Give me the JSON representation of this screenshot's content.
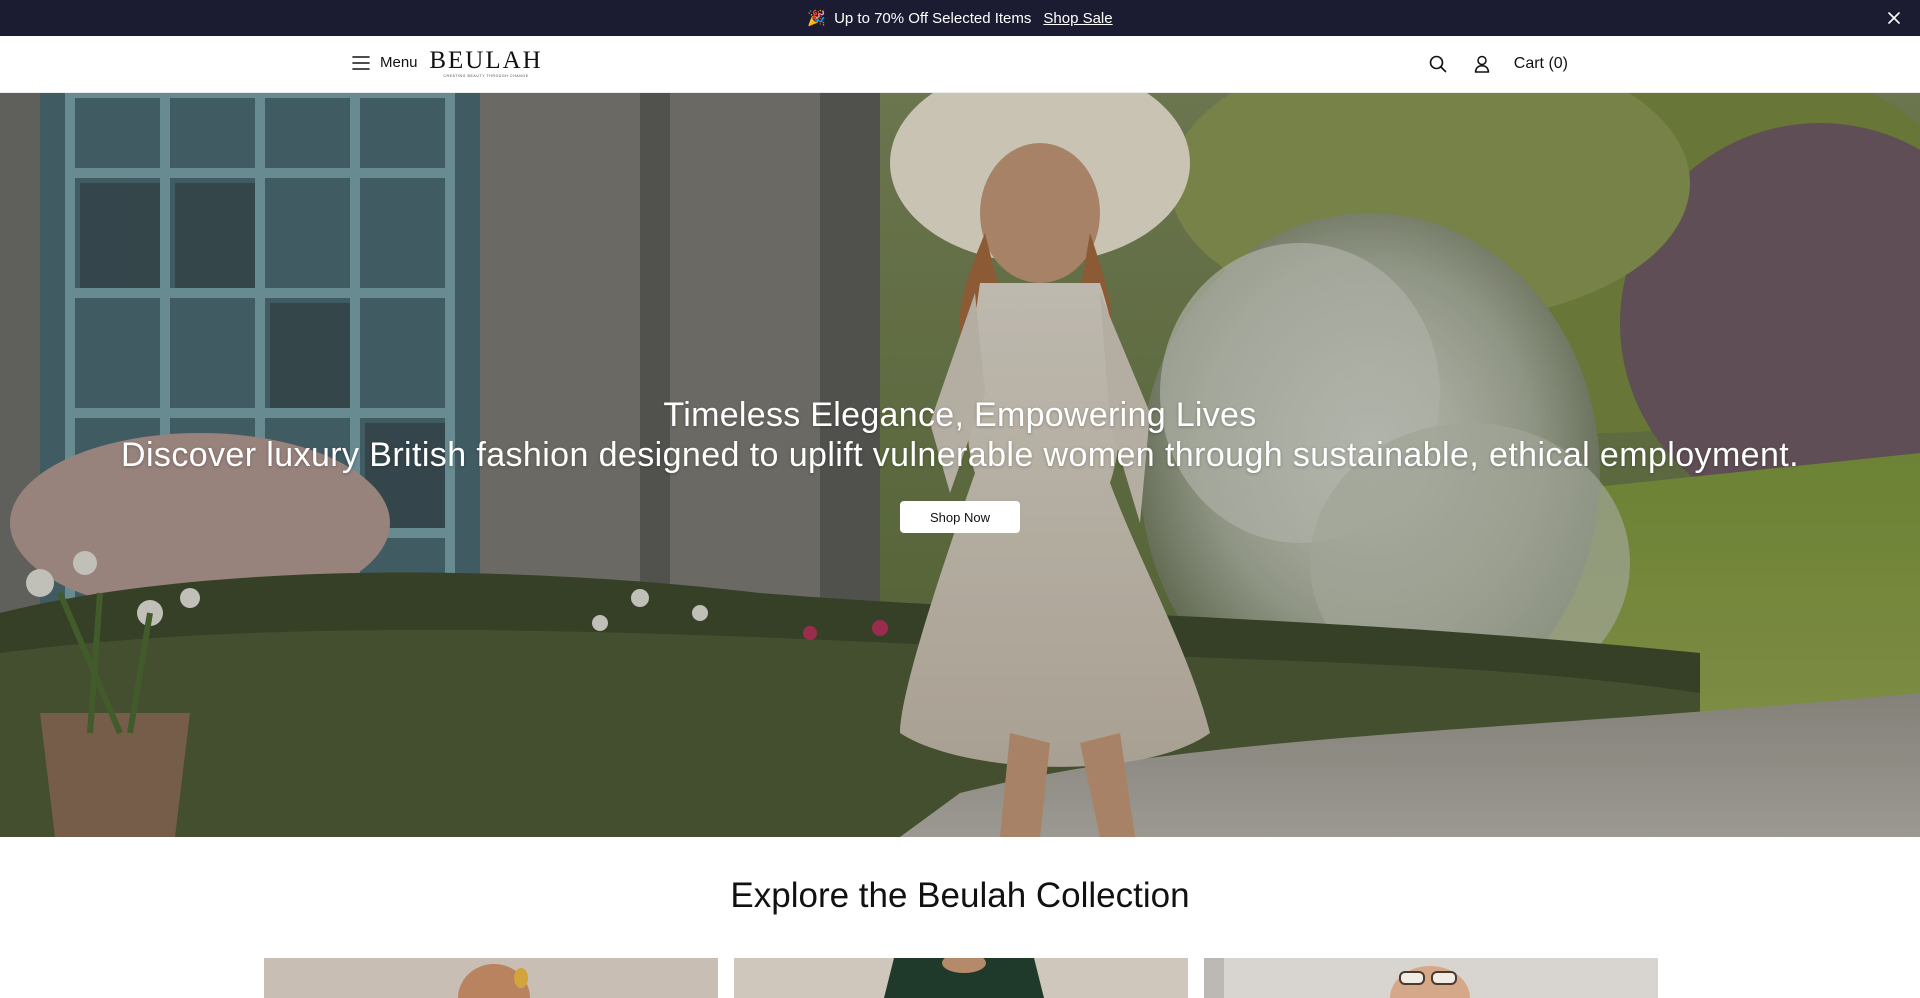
{
  "announcement": {
    "emoji": "🎉",
    "text": "Up to 70% Off Selected Items",
    "link": "Shop Sale",
    "close_icon": "close-icon"
  },
  "header": {
    "menu_label": "Menu",
    "logo_word": "BEULAH",
    "logo_tagline": "CREATING BEAUTY THROUGH CHANGE",
    "cart_label": "Cart (0)",
    "icons": [
      "hamburger-icon",
      "search-icon",
      "account-icon"
    ]
  },
  "hero": {
    "title": "Timeless Elegance, Empowering Lives",
    "subtitle": "Discover luxury British fashion designed to uplift vulnerable women through sustainable, ethical employment.",
    "cta": "Shop Now"
  },
  "collection": {
    "title": "Explore the Beulah Collection",
    "cards": [
      {
        "name": "collection-card-1"
      },
      {
        "name": "collection-card-2"
      },
      {
        "name": "collection-card-3"
      }
    ]
  },
  "colors": {
    "announcement_bg": "#1b1b32",
    "header_bg": "#ffffff",
    "button_bg": "#ffffff",
    "text": "#111111"
  }
}
